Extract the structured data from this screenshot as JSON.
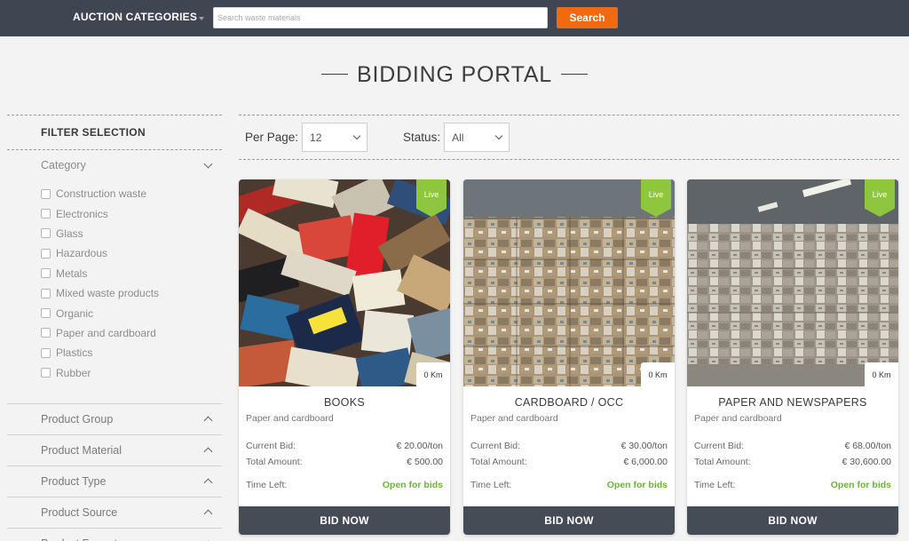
{
  "header": {
    "categories_label": "AUCTION CATEGORIES",
    "search_placeholder": "Search waste materials",
    "search_label": "Search"
  },
  "page_title": "BIDDING PORTAL",
  "filters": {
    "heading": "FILTER SELECTION",
    "category_label": "Category",
    "categories": [
      "Construction waste",
      "Electronics",
      "Glass",
      "Hazardous",
      "Metals",
      "Mixed waste products",
      "Organic",
      "Paper and cardboard",
      "Plastics",
      "Rubber"
    ],
    "groups": [
      "Product Group",
      "Product Material",
      "Product Type",
      "Product Source",
      "Product Format"
    ]
  },
  "controls": {
    "per_page_label": "Per Page:",
    "per_page_value": "12",
    "status_label": "Status:",
    "status_value": "All"
  },
  "labels": {
    "current_bid": "Current Bid:",
    "total_amount": "Total Amount:",
    "time_left": "Time Left:",
    "bid_now": "BID NOW",
    "live": "Live"
  },
  "listings": [
    {
      "title": "BOOKS",
      "category": "Paper and cardboard",
      "distance": "0 Km",
      "current_bid": "€ 20.00/ton",
      "total_amount": "€ 500.00",
      "time_left": "Open for bids",
      "status": "Live"
    },
    {
      "title": "CARDBOARD / OCC",
      "category": "Paper and cardboard",
      "distance": "0 Km",
      "current_bid": "€ 30.00/ton",
      "total_amount": "€ 6,000.00",
      "time_left": "Open for bids",
      "status": "Live"
    },
    {
      "title": "PAPER AND NEWSPAPERS",
      "category": "Paper and cardboard",
      "distance": "0 Km",
      "current_bid": "€ 68.00/ton",
      "total_amount": "€ 30,600.00",
      "time_left": "Open for bids",
      "status": "Live"
    }
  ],
  "colors": {
    "topbar": "#3f4551",
    "search_button": "#f26a10",
    "live_tag": "#8ec63f",
    "open_for_bids": "#6ab33b",
    "bid_button": "#464c56"
  }
}
